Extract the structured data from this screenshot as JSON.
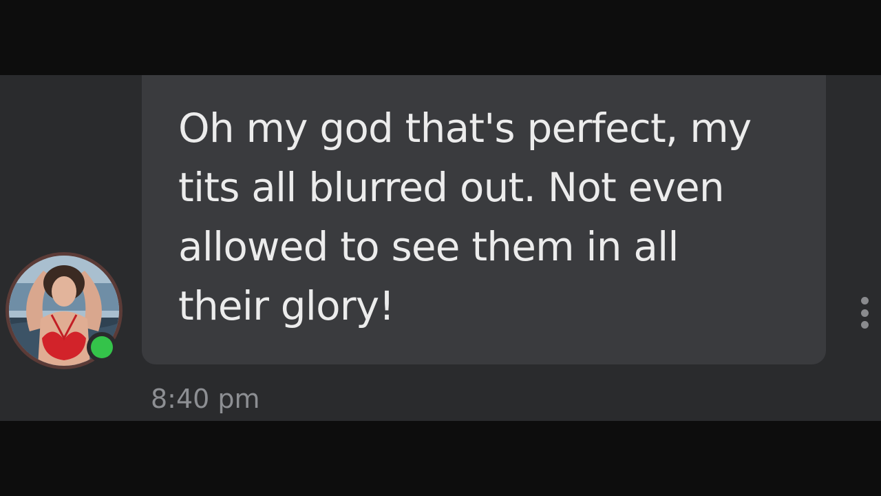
{
  "message": {
    "text": "Oh my god that's perfect, my\ntits all blurred out. Not even\nallowed to see them in all\ntheir glory!",
    "timestamp": "8:40 pm"
  },
  "sender": {
    "avatar_icon": "user-avatar-photo",
    "presence": "online",
    "presence_color": "#34c34a"
  },
  "actions": {
    "more_icon": "more-vertical-icon"
  },
  "colors": {
    "background": "#2a2b2d",
    "bubble": "#3a3b3e",
    "text": "#ececec",
    "timestamp": "#8d8f93"
  }
}
